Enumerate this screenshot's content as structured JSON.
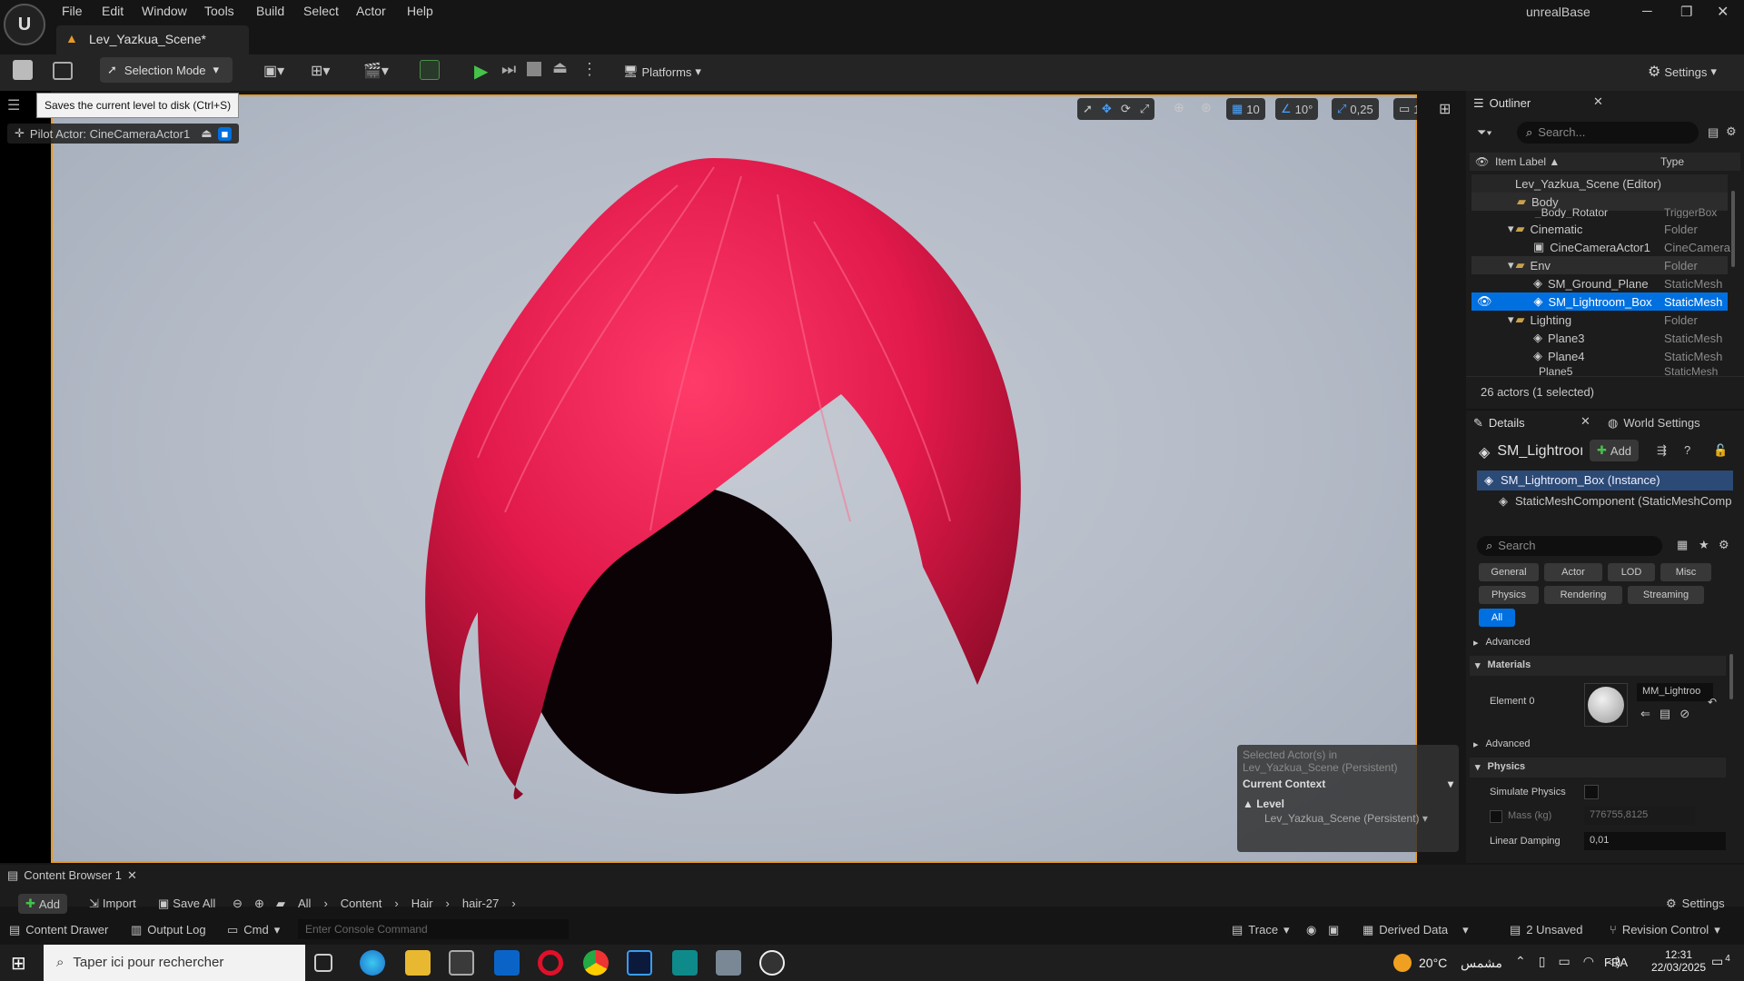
{
  "app": {
    "project_name": "unrealBase",
    "logo_glyph": "U"
  },
  "menu": [
    "File",
    "Edit",
    "Window",
    "Tools",
    "Build",
    "Select",
    "Actor",
    "Help"
  ],
  "document_tab": {
    "title": "Lev_Yazkua_Scene*"
  },
  "toolbar": {
    "selection_mode": "Selection Mode",
    "platforms": "Platforms",
    "settings": "Settings",
    "tooltip": "Saves the current level to disk (Ctrl+S)"
  },
  "viewport": {
    "pilot_label": "Pilot Actor: CineCameraActor1",
    "grid_snap": "10",
    "rot_snap": "10°",
    "scale_snap": "0,25",
    "camera_speed": "1",
    "context": {
      "selected_line1": "Selected Actor(s) in",
      "selected_line2": "Lev_Yazkua_Scene (Persistent)",
      "current_context": "Current Context",
      "level_label": "Level",
      "level_value": "Lev_Yazkua_Scene (Persistent)"
    }
  },
  "outliner": {
    "title": "Outliner",
    "search_placeholder": "Search...",
    "col_label": "Item Label ▲",
    "col_type": "Type",
    "rows": [
      {
        "label": "Lev_Yazkua_Scene (Editor)",
        "type": ""
      },
      {
        "label": "Body",
        "type": ""
      },
      {
        "label": "_Body_Rotator",
        "type": "TriggerBox"
      },
      {
        "label": "Cinematic",
        "type": "Folder"
      },
      {
        "label": "CineCameraActor1",
        "type": "CineCamera"
      },
      {
        "label": "Env",
        "type": "Folder"
      },
      {
        "label": "SM_Ground_Plane",
        "type": "StaticMesh"
      },
      {
        "label": "SM_Lightroom_Box",
        "type": "StaticMesh"
      },
      {
        "label": "Lighting",
        "type": "Folder"
      },
      {
        "label": "Plane3",
        "type": "StaticMesh"
      },
      {
        "label": "Plane4",
        "type": "StaticMesh"
      },
      {
        "label": "Plane5",
        "type": "StaticMesh"
      }
    ],
    "status": "26 actors (1 selected)"
  },
  "details": {
    "tab_details": "Details",
    "tab_world": "World Settings",
    "actor_name": "SM_Lightrooı",
    "add_label": "Add",
    "instance": "SM_Lightroom_Box (Instance)",
    "component": "StaticMeshComponent (StaticMeshComp",
    "search_placeholder": "Search",
    "filters": [
      "General",
      "Actor",
      "LOD",
      "Misc",
      "Physics",
      "Rendering",
      "Streaming",
      "All"
    ],
    "advanced1": "Advanced",
    "materials_header": "Materials",
    "element0": "Element 0",
    "material_name": "MM_Lightroo",
    "advanced2": "Advanced",
    "physics_header": "Physics",
    "simulate_physics": "Simulate Physics",
    "mass_label": "Mass (kg)",
    "mass_value": "776755,8125",
    "linear_damping": "Linear Damping",
    "linear_damping_value": "0,01"
  },
  "content_browser": {
    "tab": "Content Browser 1",
    "add": "Add",
    "import": "Import",
    "save_all": "Save All",
    "breadcrumb": [
      "All",
      "Content",
      "Hair",
      "hair-27"
    ],
    "settings": "Settings"
  },
  "statusbar": {
    "content_drawer": "Content Drawer",
    "output_log": "Output Log",
    "cmd": "Cmd",
    "console_placeholder": "Enter Console Command",
    "trace": "Trace",
    "derived_data": "Derived Data",
    "unsaved": "2 Unsaved",
    "revision_control": "Revision Control"
  },
  "taskbar": {
    "search_placeholder": "Taper ici pour rechercher",
    "weather": "20°C",
    "weather_text": "مشمس",
    "lang": "FRA",
    "time": "12:31",
    "date": "22/03/2025",
    "notifications": "4"
  },
  "colors": {
    "accent": "#0070e0",
    "hair": "#e0194a",
    "frame": "#e79a22"
  }
}
